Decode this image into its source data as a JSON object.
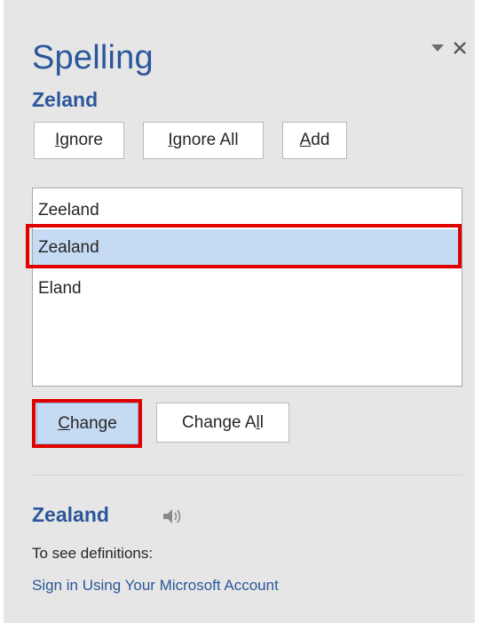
{
  "pane": {
    "title": "Spelling",
    "dropdown_icon": "chevron-down-icon",
    "close_icon": "close-icon",
    "close_glyph": "✕"
  },
  "misspelled": {
    "word": "Zeland"
  },
  "actions": {
    "ignore": {
      "pre": "",
      "u": "I",
      "post": "gnore"
    },
    "ignore_all": {
      "pre": "",
      "u": "I",
      "post": "gnore All"
    },
    "add": {
      "pre": "",
      "u": "A",
      "post": "dd"
    }
  },
  "suggestions": {
    "items": [
      "Zeeland",
      "Zealand",
      "Eland"
    ],
    "selected_index": 1
  },
  "change": {
    "change": {
      "pre": "",
      "u": "C",
      "post": "hange"
    },
    "change_all": {
      "pre": "Change A",
      "u": "l",
      "post": "l"
    }
  },
  "definition": {
    "word": "Zealand",
    "speaker_icon": "speaker-icon",
    "prompt": "To see definitions:",
    "signin_link": "Sign in Using Your Microsoft Account"
  },
  "colors": {
    "accent": "#2b579a",
    "selection": "#c5daf3",
    "highlight": "#e00000",
    "pane_bg": "#e6e6e6"
  }
}
